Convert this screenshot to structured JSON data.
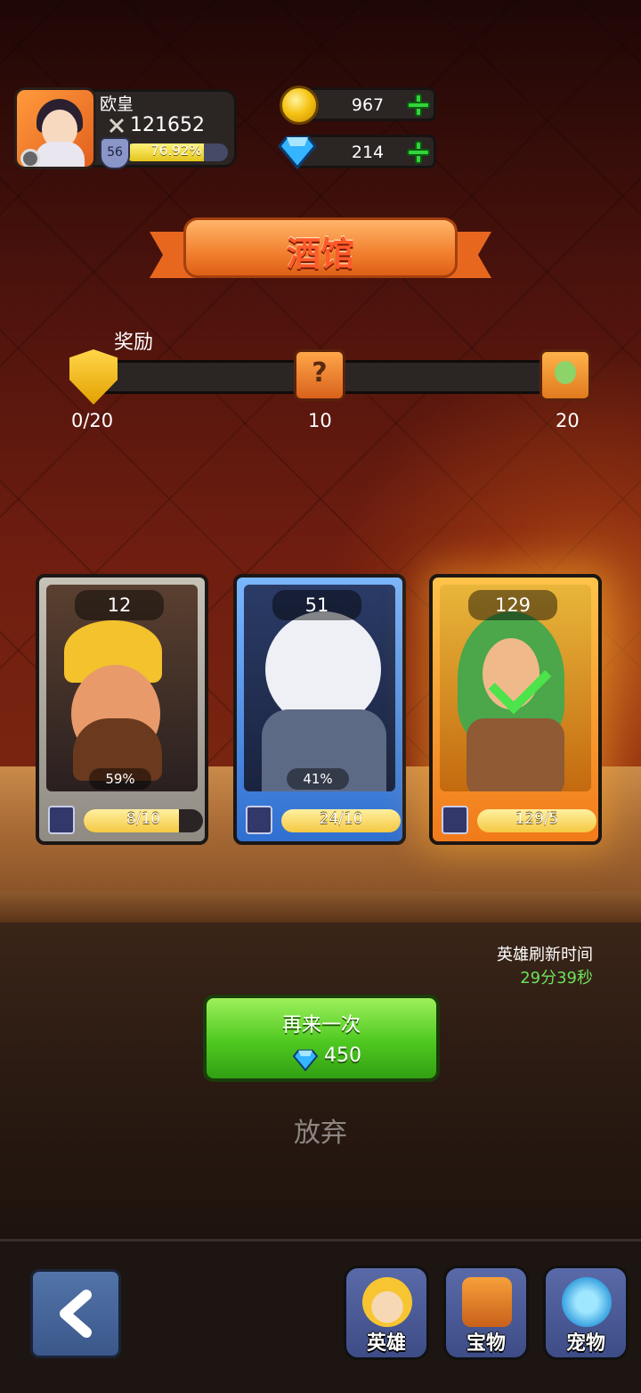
{
  "player": {
    "name": "欧皇",
    "power": "121652",
    "level": "56",
    "xp_percent": "76.92%",
    "xp_fraction": 0.7692
  },
  "currency": {
    "gold": "967",
    "gems": "214"
  },
  "screen_title": "酒馆",
  "reward": {
    "label": "奖励",
    "progress": "0/20",
    "milestones": [
      "10",
      "20"
    ]
  },
  "cards": [
    {
      "count": "12",
      "percent": "59%",
      "shards": "8/10",
      "fill": 0.8,
      "theme": "gray"
    },
    {
      "count": "51",
      "percent": "41%",
      "shards": "24/10",
      "fill": 1.0,
      "theme": "blue"
    },
    {
      "count": "129",
      "percent": "",
      "shards": "129/5",
      "fill": 1.0,
      "theme": "gold"
    }
  ],
  "refresh": {
    "label": "英雄刷新时间",
    "time": "29分39秒"
  },
  "again_button": {
    "label": "再来一次",
    "cost": "450"
  },
  "give_up": "放弃",
  "nav": {
    "heroes": "英雄",
    "treasure": "宝物",
    "pets": "宠物"
  },
  "colors": {
    "accent_green": "#4ec820",
    "banner_orange": "#f2802f",
    "timer_green": "#6ee05a"
  }
}
